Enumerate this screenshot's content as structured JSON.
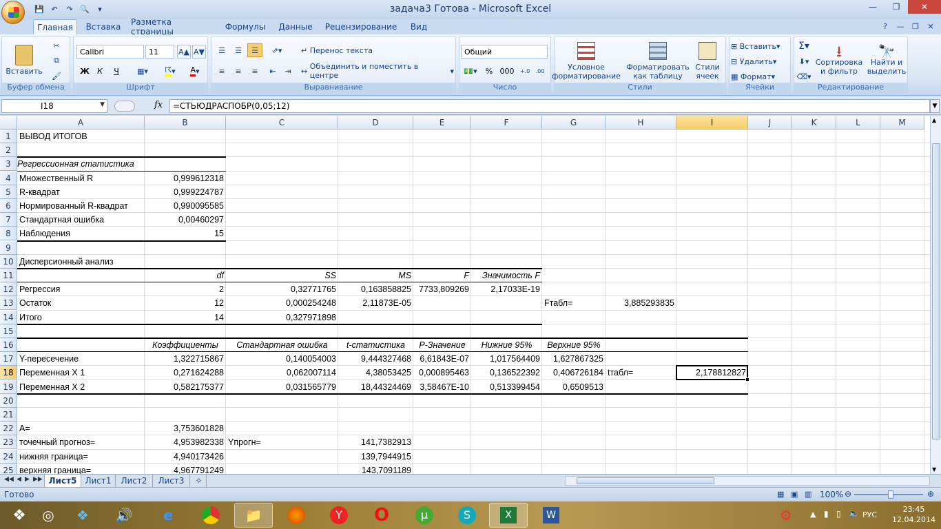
{
  "window": {
    "title": "задача3 Готова - Microsoft Excel"
  },
  "tabs": [
    {
      "label": "Главная"
    },
    {
      "label": "Вставка"
    },
    {
      "label": "Разметка страницы"
    },
    {
      "label": "Формулы"
    },
    {
      "label": "Данные"
    },
    {
      "label": "Рецензирование"
    },
    {
      "label": "Вид"
    }
  ],
  "ribbon": {
    "clipboard": {
      "label": "Буфер обмена",
      "paste": "Вставить"
    },
    "font": {
      "label": "Шрифт",
      "name": "Calibri",
      "size": "11",
      "bold": "Ж",
      "italic": "К",
      "underline": "Ч"
    },
    "alignment": {
      "label": "Выравнивание",
      "wrap": "Перенос текста",
      "merge": "Объединить и поместить в центре"
    },
    "number": {
      "label": "Число",
      "format": "Общий",
      "percent": "%",
      "thousands": "000"
    },
    "styles": {
      "label": "Стили",
      "conditional": "Условное форматирование",
      "as_table": "Форматировать как таблицу",
      "cell_styles": "Стили ячеек"
    },
    "cells": {
      "label": "Ячейки",
      "insert": "Вставить",
      "delete": "Удалить",
      "format": "Формат"
    },
    "editing": {
      "label": "Редактирование",
      "sort": "Сортировка и фильтр",
      "find": "Найти и выделить"
    }
  },
  "formula_bar": {
    "name_box": "I18",
    "fx": "fx",
    "formula": "=СТЬЮДРАСПОБР(0,05;12)"
  },
  "columns": [
    "A",
    "B",
    "C",
    "D",
    "E",
    "F",
    "G",
    "H",
    "I",
    "J",
    "K",
    "L",
    "M"
  ],
  "selected": {
    "column": "I",
    "row": "18"
  },
  "rows": [
    "1",
    "2",
    "3",
    "4",
    "5",
    "6",
    "7",
    "8",
    "9",
    "10",
    "11",
    "12",
    "13",
    "14",
    "15",
    "16",
    "17",
    "18",
    "19",
    "20",
    "21",
    "22",
    "23",
    "24",
    "25"
  ],
  "cells": {
    "A1": "ВЫВОД ИТОГОВ",
    "A3": "Регрессионная статистика",
    "A4": "Множественный R",
    "B4": "0,999612318",
    "A5": "R-квадрат",
    "B5": "0,999224787",
    "A6": "Нормированный R-квадрат",
    "B6": "0,990095585",
    "A7": "Стандартная ошибка",
    "B7": "0,00460297",
    "A8": "Наблюдения",
    "B8": "15",
    "A10": "Дисперсионный анализ",
    "B11": "df",
    "C11": "SS",
    "D11": "MS",
    "E11": "F",
    "F11": "Значимость F",
    "A12": "Регрессия",
    "B12": "2",
    "C12": "0,32771765",
    "D12": "0,163858825",
    "E12": "7733,809269",
    "F12": "2,17033E-19",
    "A13": "Остаток",
    "B13": "12",
    "C13": "0,000254248",
    "D13": "2,11873E-05",
    "G13": "Fтабл=",
    "H13": "3,885293835",
    "A14": "Итого",
    "B14": "14",
    "C14": "0,327971898",
    "B16": "Коэффициенты",
    "C16": "Стандартная ошибка",
    "D16": "t-статистика",
    "E16": "P-Значение",
    "F16": "Нижние 95%",
    "G16": "Верхние 95%",
    "A17": "Y-пересечение",
    "B17": "1,322715867",
    "C17": "0,140054003",
    "D17": "9,444327468",
    "E17": "6,61843E-07",
    "F17": "1,017564409",
    "G17": "1,627867325",
    "A18": "Переменная X 1",
    "B18": "0,271624288",
    "C18": "0,062007114",
    "D18": "4,38053425",
    "E18": "0,000895463",
    "F18": "0,136522392",
    "G18": "0,406726184",
    "H18": "tтабл=",
    "I18": "2,178812827",
    "A19": "Переменная X 2",
    "B19": "0,582175377",
    "C19": "0,031565779",
    "D19": "18,44324469",
    "E19": "3,58467E-10",
    "F19": "0,513399454",
    "G19": "0,6509513",
    "A22": "A=",
    "B22": "3,753601828",
    "A23": "точечный прогноз=",
    "B23": "4,953982338",
    "C23": "Yпрогн=",
    "D23": "141,7382913",
    "A24": "нижняя граница=",
    "B24": "4,940173426",
    "D24": "139,7944915",
    "A25": "верхняя граница=",
    "B25": "4,967791249",
    "D25": "143,7091189"
  },
  "sheet_tabs": [
    "Лист5",
    "Лист1",
    "Лист2",
    "Лист3"
  ],
  "status": {
    "ready": "Готово",
    "zoom": "100%"
  },
  "taskbar": {
    "lang": "РУС",
    "time": "23:45",
    "date": "12.04.2014"
  }
}
